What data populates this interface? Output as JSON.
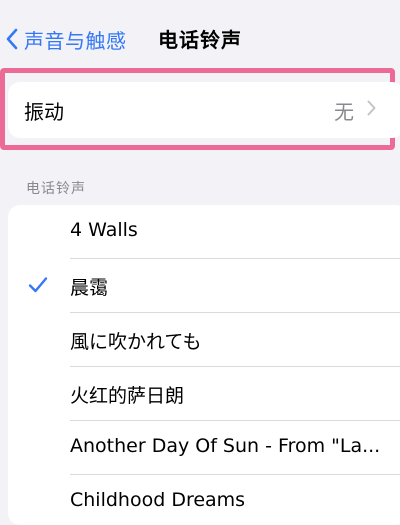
{
  "nav": {
    "back_label": "声音与触感",
    "title": "电话铃声"
  },
  "vibration": {
    "label": "振动",
    "value": "无"
  },
  "ringtones": {
    "section_header": "电话铃声",
    "items": [
      {
        "label": "4 Walls",
        "selected": false
      },
      {
        "label": "晨霭",
        "selected": true
      },
      {
        "label": "風に吹かれても",
        "selected": false
      },
      {
        "label": "火红的萨日朗",
        "selected": false
      },
      {
        "label": "Another Day Of Sun - From \"La...",
        "selected": false
      },
      {
        "label": "Childhood Dreams",
        "selected": false
      }
    ]
  },
  "colors": {
    "accent": "#3478f6",
    "highlight": "#ec6b96",
    "background": "#f2f2f7",
    "secondary_text": "#8a8a8e"
  },
  "icons": {
    "back": "chevron-left-icon",
    "disclosure": "chevron-right-icon",
    "selected": "checkmark-icon"
  }
}
